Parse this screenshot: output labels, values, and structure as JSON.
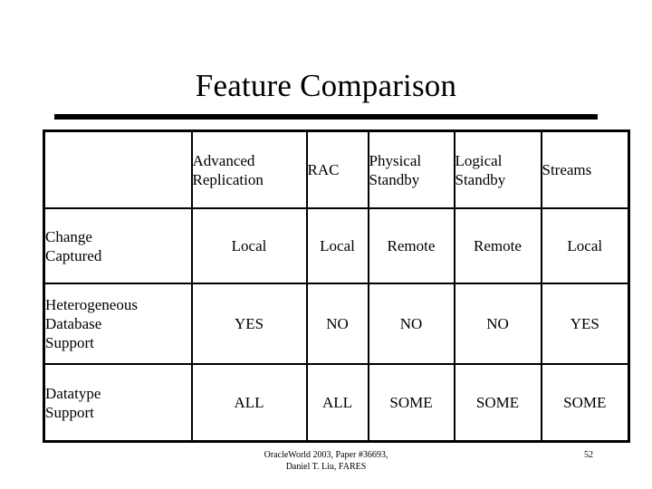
{
  "slide": {
    "title": "Feature Comparison",
    "page_number": "52",
    "footer": {
      "line1": "OracleWorld 2003, Paper #36693,",
      "line2": "Daniel T. Liu, FARES"
    },
    "colors": {
      "background": "#ffffff",
      "text": "#000000",
      "rule": "#000000",
      "table_border": "#000000"
    }
  },
  "table": {
    "corner_label": "",
    "columns": [
      {
        "line1": "Advanced",
        "line2": "Replication"
      },
      {
        "line1": "RAC",
        "line2": ""
      },
      {
        "line1": "Physical",
        "line2": "Standby"
      },
      {
        "line1": "Logical",
        "line2": "Standby"
      },
      {
        "line1": "Streams",
        "line2": ""
      }
    ],
    "rows": [
      {
        "label": {
          "line1": "Change",
          "line2": "Captured",
          "line3": ""
        },
        "values": [
          "Local",
          "Local",
          "Remote",
          "Remote",
          "Local"
        ]
      },
      {
        "label": {
          "line1": "Heterogeneous",
          "line2": "Database",
          "line3": "Support"
        },
        "values": [
          "YES",
          "NO",
          "NO",
          "NO",
          "YES"
        ]
      },
      {
        "label": {
          "line1": "Datatype",
          "line2": "Support",
          "line3": ""
        },
        "values": [
          "ALL",
          "ALL",
          "SOME",
          "SOME",
          "SOME"
        ]
      }
    ]
  }
}
